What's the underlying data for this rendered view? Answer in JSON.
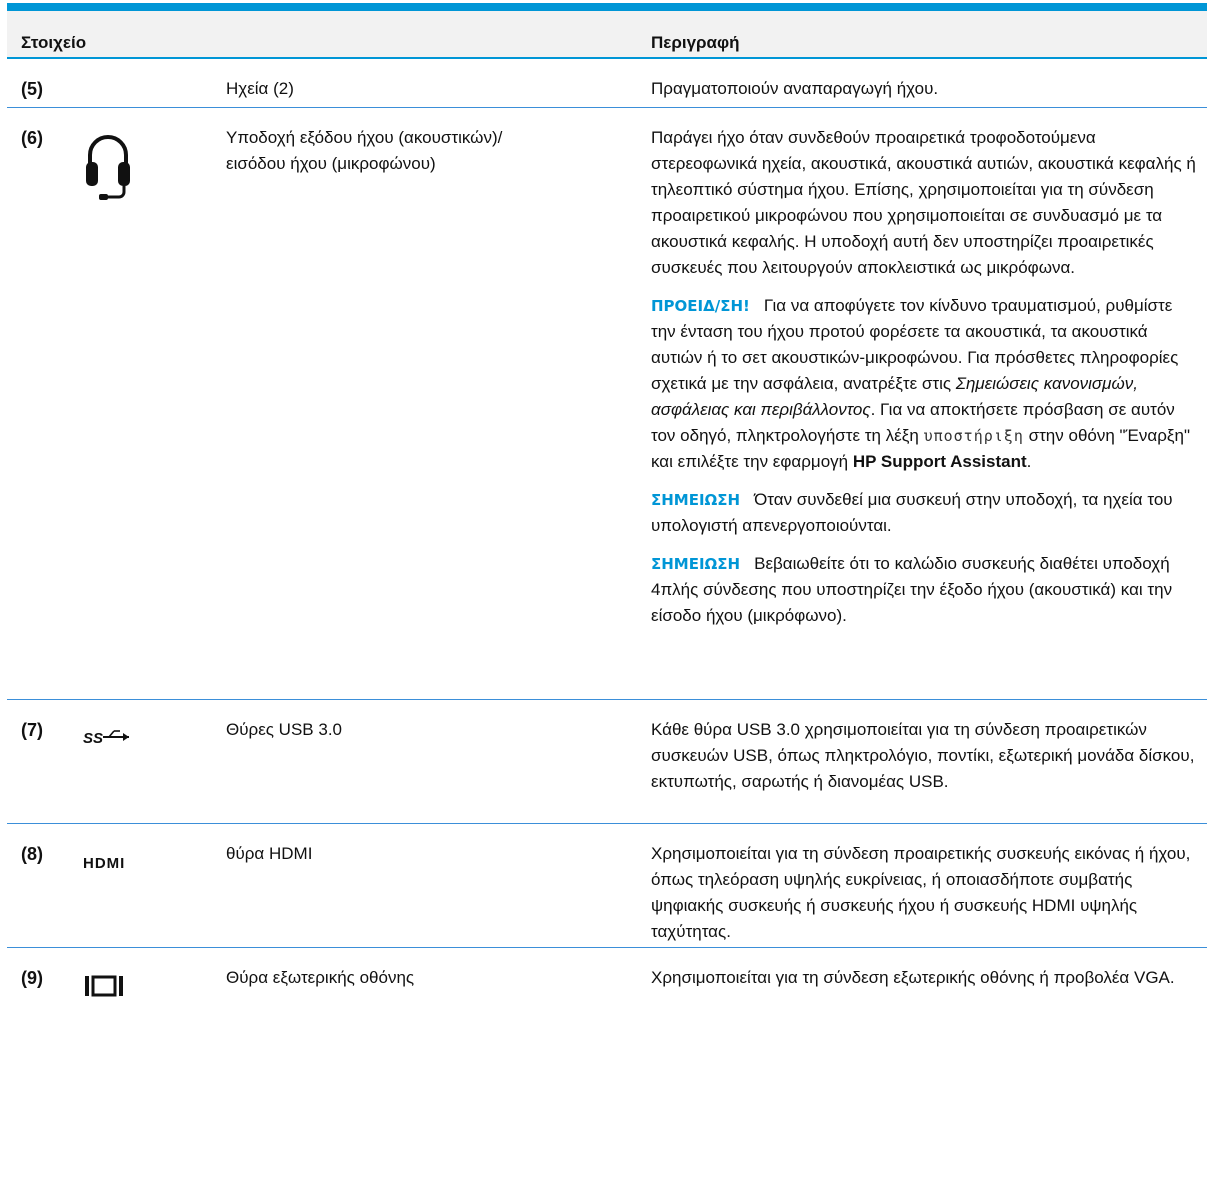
{
  "table": {
    "header": {
      "component": "Στοιχείο",
      "description": "Περιγραφή"
    },
    "rows": [
      {
        "num": "(5)",
        "icon": "",
        "component": "Ηχεία (2)",
        "description": "Πραγματοποιούν αναπαραγωγή ήχου."
      },
      {
        "num": "(6)",
        "icon": "headset-icon",
        "component_line1": "Υποδοχή εξόδου ήχου (ακουστικών)/",
        "component_line2": "εισόδου ήχου (μικροφώνου)",
        "description": "Παράγει ήχο όταν συνδεθούν προαιρετικά τροφοδοτούμενα στερεοφωνικά ηχεία, ακουστικά, ακουστικά αυτιών, ακουστικά κεφαλής ή τηλεοπτικό σύστημα ήχου. Επίσης, χρησιμοποιείται για τη σύνδεση προαιρετικού μικροφώνου που χρησιμοποιείται σε συνδυασμό με τα ακουστικά κεφαλής. Η υποδοχή αυτή δεν υποστηρίζει προαιρετικές συσκευές που λειτουργούν αποκλειστικά ως μικρόφωνα.",
        "warning": {
          "label": "ΠΡΟΕΙΔ/ΣΗ!",
          "text_a": "Για να αποφύγετε τον κίνδυνο τραυματισμού, ρυθμίστε την ένταση του ήχου προτού φορέσετε τα ακουστικά, τα ακουστικά αυτιών ή το σετ ακουστικών-μικροφώνου. Για πρόσθετες πληροφορίες σχετικά με την ασφάλεια, ανατρέξτε στις ",
          "italic": "Σημειώσεις κανονισμών, ασφάλειας και περιβάλλοντος",
          "text_b": ". Για να αποκτήσετε πρόσβαση σε αυτόν τον οδηγό, πληκτρολογήστε τη λέξη ",
          "code": "υποστήριξη",
          "text_c": " στην οθόνη \"Έναρξη\" και επιλέξτε την εφαρμογή ",
          "app": "HP Support Assistant",
          "text_d": "."
        },
        "note1": {
          "label": "ΣΗΜΕΙΩΣΗ",
          "text": "Όταν συνδεθεί μια συσκευή στην υποδοχή, τα ηχεία του υπολογιστή απενεργοποιούνται."
        },
        "note2": {
          "label": "ΣΗΜΕΙΩΣΗ",
          "text": "Βεβαιωθείτε ότι το καλώδιο συσκευής διαθέτει υποδοχή 4πλής σύνδεσης που υποστηρίζει την έξοδο ήχου (ακουστικά) και την είσοδο ήχου (μικρόφωνο)."
        }
      },
      {
        "num": "(7)",
        "icon": "usb-superspeed-icon",
        "icon_text": "SS",
        "component": "Θύρες USB 3.0",
        "description": "Κάθε θύρα USB 3.0 χρησιμοποιείται για τη σύνδεση προαιρετικών συσκευών USB, όπως πληκτρολόγιο, ποντίκι, εξωτερική μονάδα δίσκου, εκτυπωτής, σαρωτής ή διανομέας USB."
      },
      {
        "num": "(8)",
        "icon": "hdmi-icon",
        "icon_text": "HDMI",
        "component": "θύρα HDMI",
        "description": "Χρησιμοποιείται για τη σύνδεση προαιρετικής συσκευής εικόνας ή ήχου, όπως τηλεόραση υψηλής ευκρίνειας, ή οποιασδήποτε συμβατής ψηφιακής συσκευής ή συσκευής ήχου ή συσκευής HDMI υψηλής ταχύτητας."
      },
      {
        "num": "(9)",
        "icon": "external-monitor-icon",
        "component": "Θύρα εξωτερικής οθόνης",
        "description": "Χρησιμοποιείται για τη σύνδεση εξωτερικής οθόνης ή προβολέα VGA."
      }
    ]
  },
  "colors": {
    "accent": "#0096d6",
    "rule": "#3b8fd9",
    "header_bg": "#f2f2f2"
  }
}
